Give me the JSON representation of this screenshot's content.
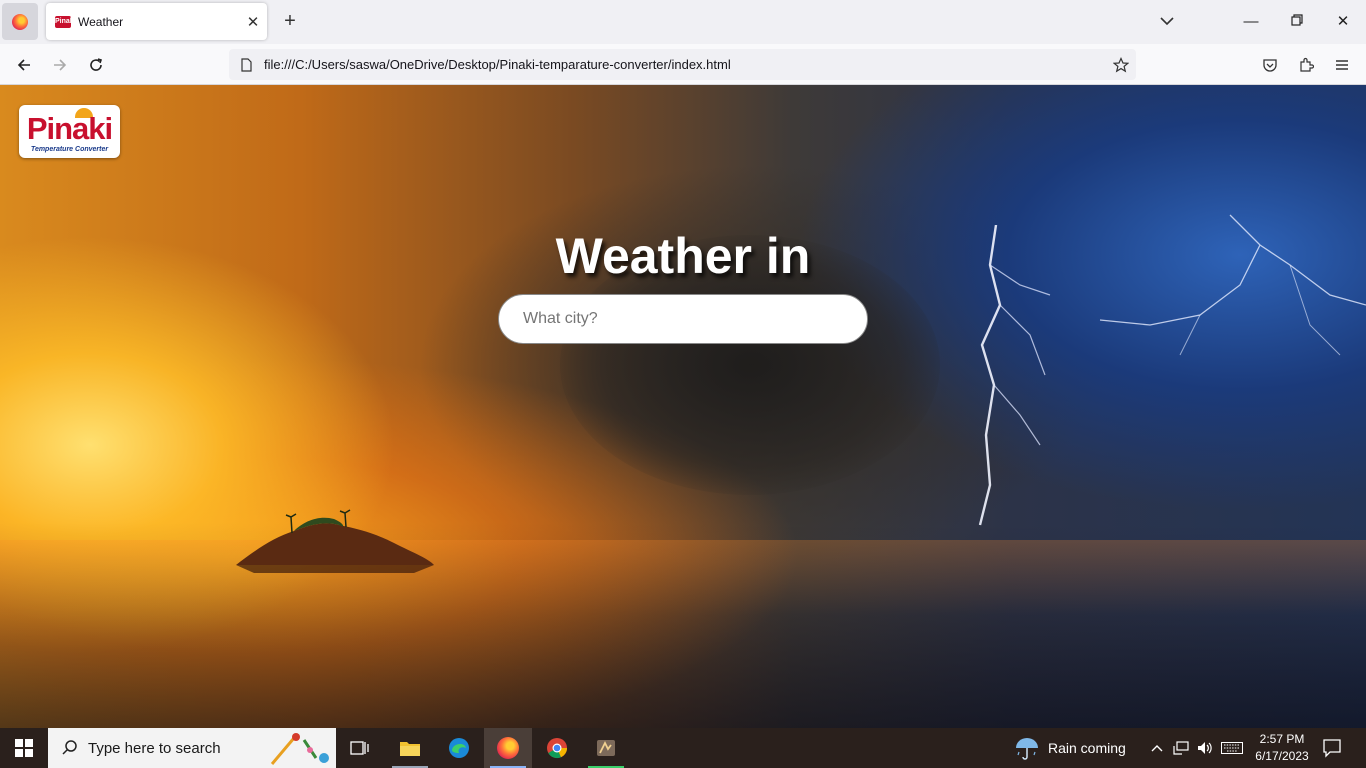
{
  "browser": {
    "tab_title": "Weather",
    "tab_favicon_text": "Pinaki",
    "url": "file:///C:/Users/saswa/OneDrive/Desktop/Pinaki-temparature-converter/index.html"
  },
  "page": {
    "logo_text": "Pinaki",
    "logo_subtitle": "Temperature Converter",
    "heading": "Weather in",
    "search_placeholder": "What city?",
    "search_value": ""
  },
  "taskbar": {
    "search_placeholder": "Type here to search",
    "weather_text": "Rain coming",
    "time": "2:57 PM",
    "date": "6/17/2023"
  }
}
